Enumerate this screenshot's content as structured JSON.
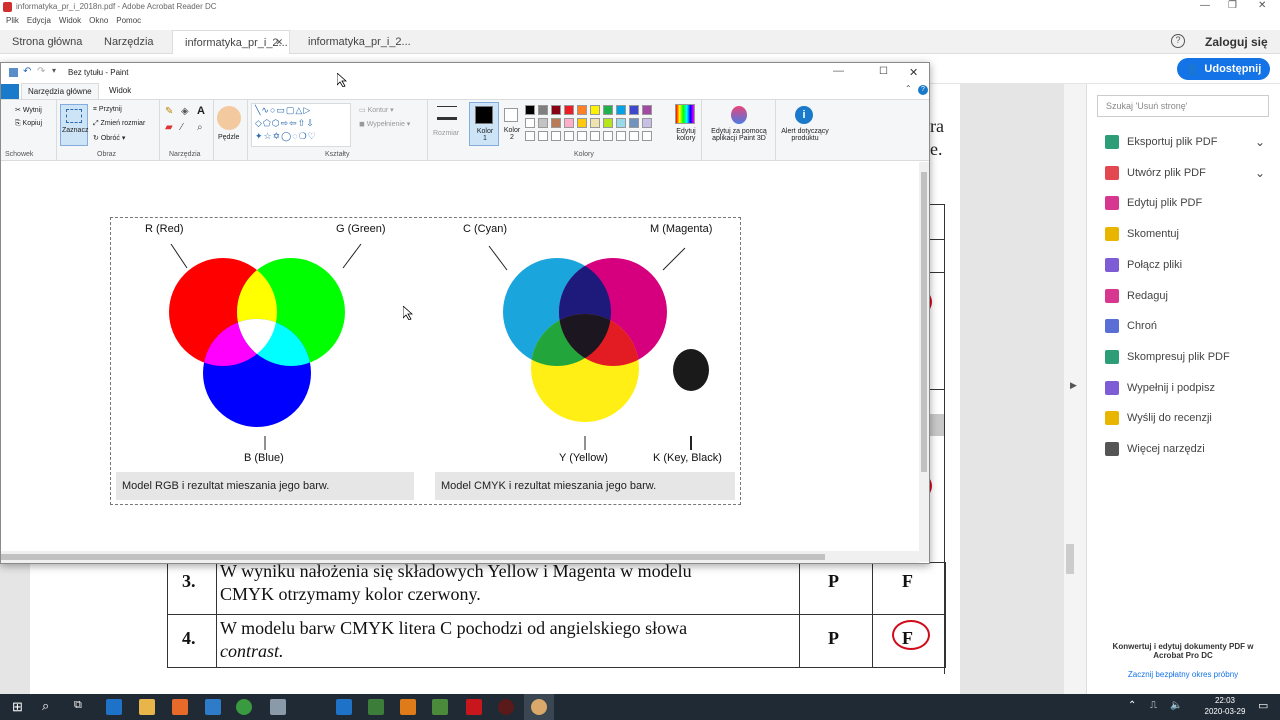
{
  "acrobat": {
    "window_title": "informatyka_pr_i_2018n.pdf - Adobe Acrobat Reader DC",
    "menu": [
      "Plik",
      "Edycja",
      "Widok",
      "Okno",
      "Pomoc"
    ],
    "tabs": [
      "Strona główna",
      "Narzędzia",
      "informatyka_pr_i_2...",
      "informatyka_pr_i_2..."
    ],
    "login": "Zaloguj się",
    "share": "Udostępnij",
    "search_placeholder": "Szukaj 'Usuń stronę'",
    "tools": [
      "Eksportuj plik PDF",
      "Utwórz plik PDF",
      "Edytuj plik PDF",
      "Skomentuj",
      "Połącz pliki",
      "Redaguj",
      "Chroń",
      "Skompresuj plik PDF",
      "Wypełnij i podpisz",
      "Wyślij do recenzji",
      "Więcej narzędzi"
    ],
    "tool_colors": [
      "#2d9d78",
      "#e34850",
      "#d83790",
      "#e8b500",
      "#7e5cd6",
      "#d83790",
      "#5a6fd6",
      "#2d9d78",
      "#7e5cd6",
      "#e8b500",
      "#555555"
    ],
    "promo_title": "Konwertuj i edytuj dokumenty PDF w Acrobat Pro DC",
    "promo_link": "Zacznij bezpłatny okres próbny"
  },
  "paint": {
    "title": "Bez tytułu - Paint",
    "ribbon_tabs": [
      "Narzędzia główne",
      "Widok"
    ],
    "clipboard": {
      "cut": "Wytnij",
      "copy": "Kopiuj",
      "label": "Schowek"
    },
    "image": {
      "select": "Zaznacz",
      "crop": "Przytnij",
      "resize": "Zmień rozmiar",
      "rotate": "Obróć",
      "label": "Obraz"
    },
    "tools_label": "Narzędzia",
    "brushes": "Pędzle",
    "shapes_label": "Kształty",
    "outline": "Kontur",
    "fill": "Wypełnienie",
    "size": "Rozmiar",
    "color1": "Kolor 1",
    "color2": "Kolor 2",
    "colors_label": "Kolory",
    "edit_colors": "Edytuj kolory",
    "paint3d": "Edytuj za pomocą aplikacji Paint 3D",
    "alert": "Alert dotyczący produktu",
    "palette": [
      "#000000",
      "#7f7f7f",
      "#880015",
      "#ed1c24",
      "#ff7f27",
      "#fff200",
      "#22b14c",
      "#00a2e8",
      "#3f48cc",
      "#a349a4",
      "#ffffff",
      "#c3c3c3",
      "#b97a57",
      "#ffaec9",
      "#ffc90e",
      "#efe4b0",
      "#b5e61d",
      "#99d9ea",
      "#7092be",
      "#c8bfe7"
    ]
  },
  "diagram": {
    "rgb_labels": {
      "r": "R (Red)",
      "g": "G (Green)",
      "b": "B (Blue)"
    },
    "rgb_caption": "Model RGB i rezultat mieszania jego barw.",
    "cmyk_labels": {
      "c": "C (Cyan)",
      "m": "M (Magenta)",
      "y": "Y (Yellow)",
      "k": "K (Key, Black)"
    },
    "cmyk_caption": "Model CMYK i rezultat mieszania jego barw."
  },
  "questions": [
    {
      "num": "3.",
      "line1": "W wyniku nałożenia się składowych Yellow i Magenta w modelu",
      "line2": "CMYK otrzymamy kolor czerwony.",
      "p": "P",
      "f": "F"
    },
    {
      "num": "4.",
      "line1": "W modelu barw CMYK litera C pochodzi od angielskiego słowa",
      "line2": "contrast.",
      "p": "P",
      "f": "F"
    }
  ],
  "doc_partial": [
    "ra",
    "e."
  ],
  "taskbar": {
    "time": "22:03",
    "date": "2020-03-29"
  }
}
